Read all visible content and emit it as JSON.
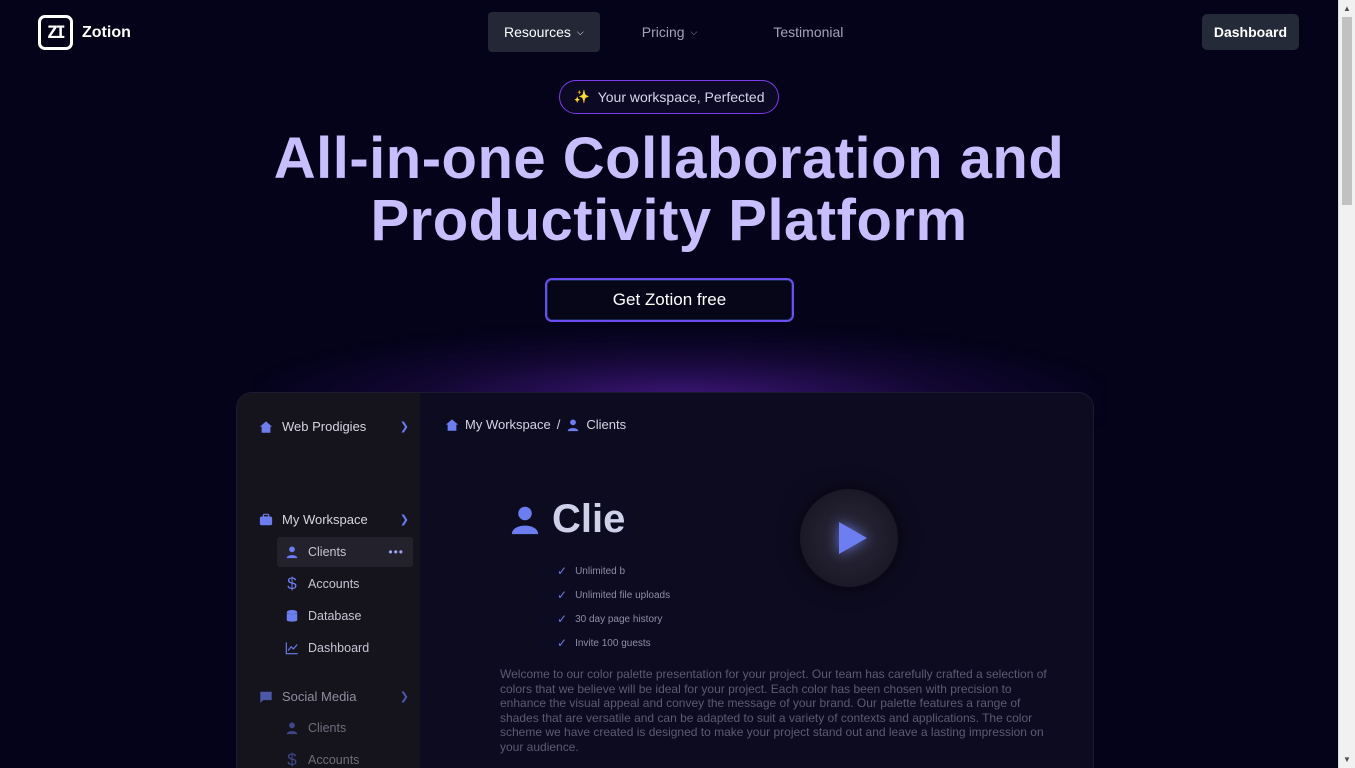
{
  "brand": {
    "name": "Zotion",
    "mark": "ZI"
  },
  "nav": {
    "items": [
      {
        "label": "Resources"
      },
      {
        "label": "Pricing"
      },
      {
        "label": "Testimonial"
      }
    ],
    "dashboard_label": "Dashboard"
  },
  "hero": {
    "badge": "Your workspace, Perfected",
    "title_line1": "All-in-one Collaboration and",
    "title_line2": "Productivity Platform",
    "cta": "Get Zotion free"
  },
  "preview": {
    "sidebar": {
      "workspace_name": "Web Prodigies",
      "groups": [
        {
          "label": "My Workspace",
          "items": [
            {
              "label": "Clients"
            },
            {
              "label": "Accounts"
            },
            {
              "label": "Database"
            },
            {
              "label": "Dashboard"
            }
          ]
        },
        {
          "label": "Social Media",
          "items": [
            {
              "label": "Clients"
            },
            {
              "label": "Accounts"
            }
          ]
        }
      ],
      "more": "•••"
    },
    "breadcrumb": {
      "root": "My Workspace",
      "separator": "/",
      "current": "Clients"
    },
    "page_title": "Clie",
    "checks": [
      "Unlimited b",
      "Unlimited file uploads",
      "30 day page history",
      "Invite 100 guests"
    ],
    "paragraph": "Welcome to our color palette presentation for your project. Our team has carefully crafted a selection of colors that we believe will be ideal for your project. Each color has been chosen with precision to enhance the visual appeal and convey the message of your brand. Our palette features a range of shades that are versatile and can be adapted to suit a variety of contexts and applications. The color scheme we have created is designed to make your project stand out and leave a lasting impression on your audience."
  },
  "colors": {
    "background": "#04031a",
    "hero_text": "#c8bdfd",
    "accent": "#6b4df1",
    "icon_blue": "#6c7df0"
  }
}
